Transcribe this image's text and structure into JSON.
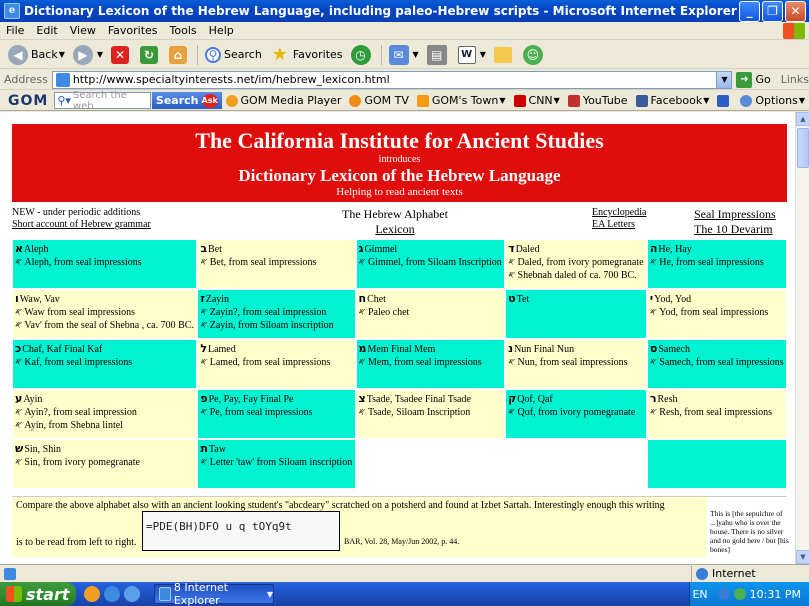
{
  "window": {
    "title": "Dictionary Lexicon of the Hebrew Language, including paleo-Hebrew scripts - Microsoft Internet Explorer",
    "min": "_",
    "max": "❐",
    "close": "✕"
  },
  "menu": [
    "File",
    "Edit",
    "View",
    "Favorites",
    "Tools",
    "Help"
  ],
  "toolbar": {
    "back": "Back",
    "search": "Search",
    "favorites": "Favorites"
  },
  "address": {
    "label": "Address",
    "url": "http://www.specialtyinterests.net/im/hebrew_lexicon.html",
    "go": "Go",
    "links": "Links"
  },
  "gom": {
    "logo": "GOM",
    "search_placeholder": "Search the web",
    "search_button": "Search",
    "ask": "Ask",
    "items": [
      "GOM Media Player",
      "GOM TV",
      "GOM's Town",
      "CNN",
      "YouTube",
      "Facebook"
    ],
    "options": "Options"
  },
  "page": {
    "banner": {
      "title": "The California Institute for Ancient Studies",
      "introduces": "introduces",
      "subtitle": "Dictionary Lexicon of the Hebrew Language",
      "tagline": "Helping to read ancient texts"
    },
    "nav": {
      "new_note": "NEW - under periodic additions",
      "grammar_link": "Short account of Hebrew grammar",
      "alphabet_label": "The Hebrew Alphabet",
      "lexicon_link": "Lexicon",
      "encyclopedia_link": "Encyclopedia",
      "ea_letters_link": "EA Letters",
      "seal_link": "Seal Impressions",
      "devarim_link": "The 10 Devarim"
    },
    "rows": [
      [
        {
          "bg": "cy",
          "glyph": "א",
          "name": "Aleph",
          "lines": [
            "Aleph, from seal impressions"
          ]
        },
        {
          "bg": "yl",
          "glyph": "ב",
          "name": "Bet",
          "lines": [
            "Bet, from seal impressions"
          ]
        },
        {
          "bg": "cy",
          "glyph": "ג",
          "name": "Gimmel",
          "lines": [
            "Gimmel, from Siloam Inscription"
          ]
        },
        {
          "bg": "yl",
          "glyph": "ד",
          "name": "Daled",
          "lines": [
            "Daled, from ivory pomegranate",
            "Shebnah daled of ca. 700 BC."
          ]
        },
        {
          "bg": "cy",
          "glyph": "ה",
          "name": "He, Hay",
          "lines": [
            "He, from seal impressions"
          ]
        }
      ],
      [
        {
          "bg": "yl",
          "glyph": "ו",
          "name": "Waw, Vav",
          "lines": [
            "Waw from seal impressions",
            "Vav' from the seal of Shebna , ca. 700 BC."
          ]
        },
        {
          "bg": "cy",
          "glyph": "ז",
          "name": "Zayin",
          "lines": [
            "Zayin?, from seal impression",
            "Zayin, from Siloam inscription"
          ]
        },
        {
          "bg": "yl",
          "glyph": "ח",
          "name": "Chet",
          "lines": [
            "Paleo chet"
          ]
        },
        {
          "bg": "cy",
          "glyph": "ט",
          "name": "Tet",
          "lines": []
        },
        {
          "bg": "yl",
          "glyph": "י",
          "name": "Yod, Yod",
          "lines": [
            "Yod, from seal impressions"
          ]
        }
      ],
      [
        {
          "bg": "cy",
          "glyph": "כ",
          "name": "Chaf, Kaf  Final Kaf",
          "lines": [
            "Kaf, from seal impressions"
          ]
        },
        {
          "bg": "yl",
          "glyph": "ל",
          "name": "Lamed",
          "lines": [
            "Lamed, from seal impressions"
          ]
        },
        {
          "bg": "cy",
          "glyph": "מ",
          "name": "Mem  Final Mem",
          "lines": [
            "Mem, from seal impressions"
          ]
        },
        {
          "bg": "yl",
          "glyph": "נ",
          "name": "Nun  Final Nun",
          "lines": [
            "Nun, from seal impressions"
          ]
        },
        {
          "bg": "cy",
          "glyph": "ס",
          "name": "Samech",
          "lines": [
            "Samech, from seal impressions"
          ]
        }
      ],
      [
        {
          "bg": "yl",
          "glyph": "ע",
          "name": "Ayin",
          "lines": [
            "Ayin?, from seal impression",
            "Ayin, from Shebna lintel"
          ]
        },
        {
          "bg": "cy",
          "glyph": "פ",
          "name": "Pe, Pay, Fay  Final Pe",
          "lines": [
            "Pe, from seal impressions"
          ]
        },
        {
          "bg": "yl",
          "glyph": "צ",
          "name": "Tsade, Tsadee  Final Tsade",
          "lines": [
            "Tsade, Siloam Inscription"
          ]
        },
        {
          "bg": "cy",
          "glyph": "ק",
          "name": "Qof, Qaf",
          "lines": [
            "Qof, from ivory pomegranate"
          ]
        },
        {
          "bg": "yl",
          "glyph": "ר",
          "name": "Resh",
          "lines": [
            "Resh, from seal impressions"
          ]
        }
      ],
      [
        {
          "bg": "yl",
          "glyph": "ש",
          "name": "Sin, Shin",
          "lines": [
            "Sin, from ivory pomegranate"
          ]
        },
        {
          "bg": "cy",
          "glyph": "ת",
          "name": "Taw",
          "lines": [
            "Letter 'taw' from Siloam inscription"
          ]
        },
        {
          "bg": "emp",
          "glyph": "",
          "name": "",
          "lines": []
        },
        {
          "bg": "emp",
          "glyph": "",
          "name": "",
          "lines": []
        },
        {
          "bg": "cy",
          "glyph": "",
          "name": "",
          "lines": []
        }
      ]
    ],
    "compare": {
      "line1": "Compare the above alphabet also with an ancient looking student's \"abcdeary\" scratched on a potsherd and found at Izbet Sartah. Interestingly enough this writing",
      "line2": "is to be read from left to right.",
      "abcdeary": "=PDE(BH)DFO  u q tOYq9t",
      "bar_ref": "BAR, Vol. 28, May/Jun 2002, p. 44.",
      "side_note": "This is [the sepulchre of ...]yahu who is over the house. There is no silver and no gold here / but [his bones]"
    },
    "zone": "Internet"
  },
  "taskbar": {
    "start": "start",
    "task": "8 Internet Explorer",
    "lang": "EN",
    "time": "10:31 PM"
  }
}
